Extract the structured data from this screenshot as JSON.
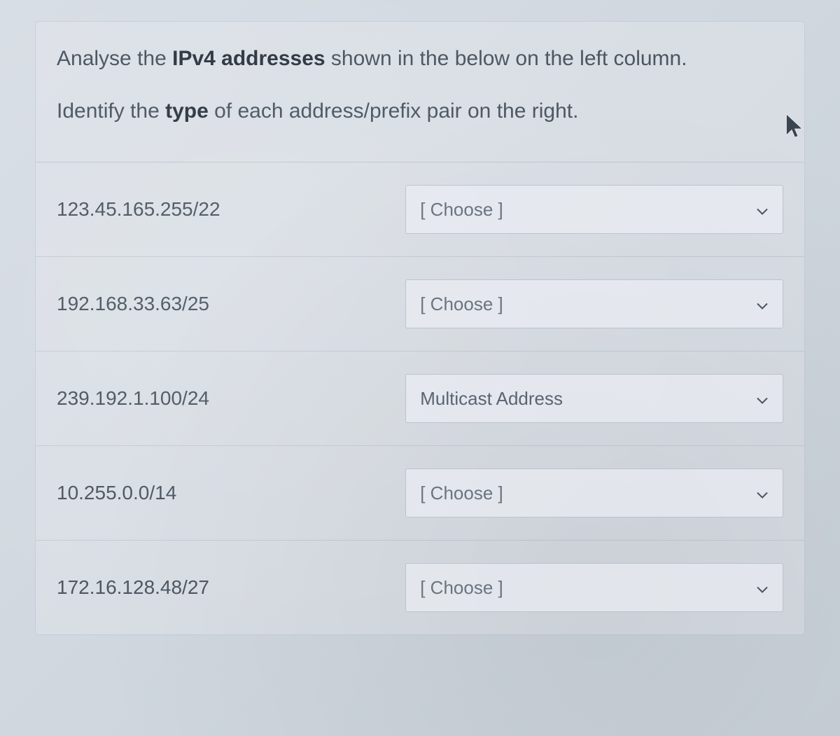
{
  "instructions": {
    "line1_pre": "Analyse the ",
    "line1_bold": "IPv4 addresses",
    "line1_post": " shown in the below on the left column.",
    "line2_pre": "Identify the ",
    "line2_bold": "type",
    "line2_post": " of each address/prefix pair on the right."
  },
  "choose_placeholder": "[ Choose ]",
  "rows": [
    {
      "address": "123.45.165.255/22",
      "selected": "[ Choose ]",
      "is_placeholder": true
    },
    {
      "address": "192.168.33.63/25",
      "selected": "[ Choose ]",
      "is_placeholder": true
    },
    {
      "address": "239.192.1.100/24",
      "selected": "Multicast Address",
      "is_placeholder": false
    },
    {
      "address": "10.255.0.0/14",
      "selected": "[ Choose ]",
      "is_placeholder": true
    },
    {
      "address": "172.16.128.48/27",
      "selected": "[ Choose ]",
      "is_placeholder": true
    }
  ]
}
